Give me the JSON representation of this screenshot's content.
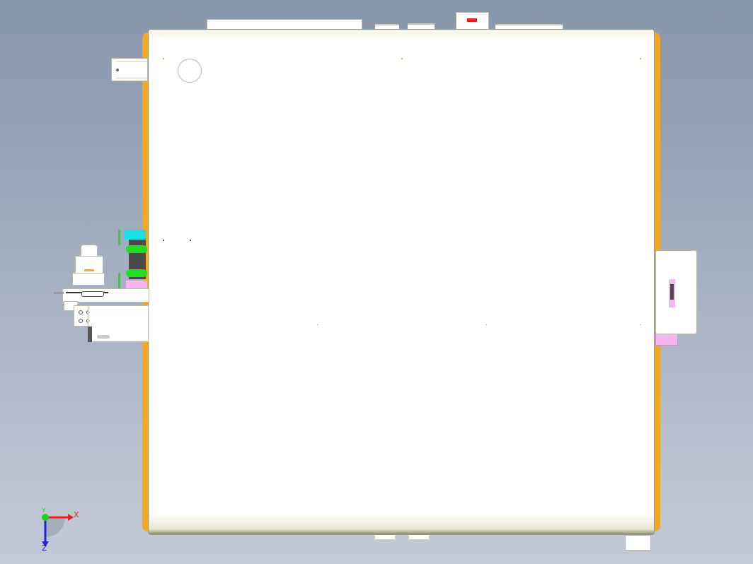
{
  "scene": {
    "background_top": "#8795ab",
    "background_bottom": "#c3cad6",
    "frame_color": "#f6a623",
    "panel_color": "#ffffff"
  },
  "colors": {
    "cyan": "#19e0e8",
    "green": "#22dd22",
    "pink": "#f4b5f0",
    "red": "#e02020",
    "dark": "#4a4a4a"
  },
  "triad": {
    "x_label": "X",
    "y_label": "Y",
    "z_label": "Z",
    "x_color": "#e32222",
    "y_color": "#1fd11f",
    "z_color": "#2222d8",
    "icon": "coordinate-triad-icon"
  }
}
